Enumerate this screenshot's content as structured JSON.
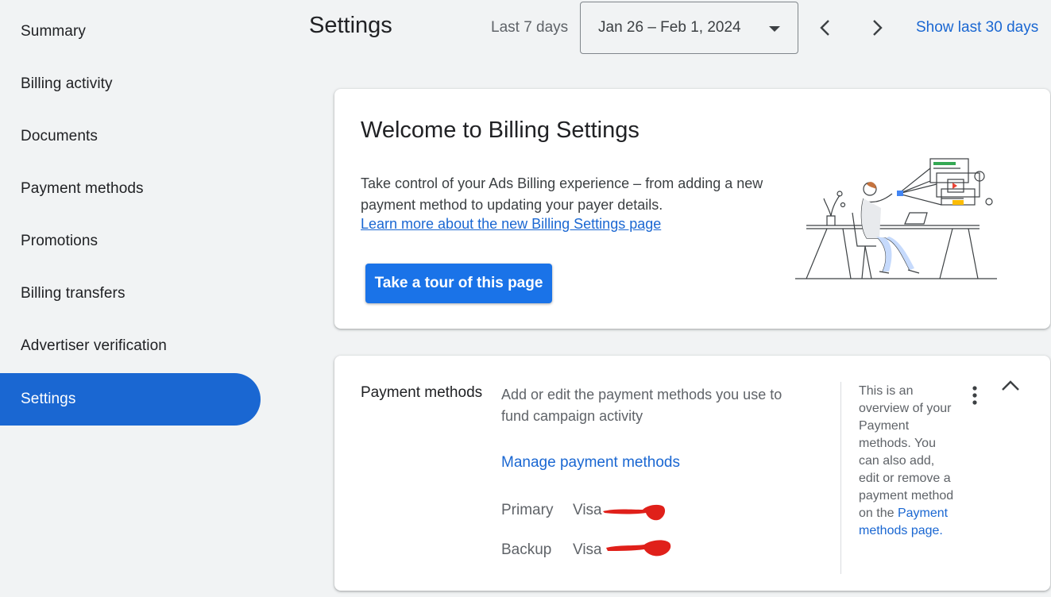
{
  "sidebar": {
    "items": [
      {
        "label": "Summary"
      },
      {
        "label": "Billing activity"
      },
      {
        "label": "Documents"
      },
      {
        "label": "Payment methods"
      },
      {
        "label": "Promotions"
      },
      {
        "label": "Billing transfers"
      },
      {
        "label": "Advertiser verification"
      },
      {
        "label": "Settings",
        "active": true
      }
    ]
  },
  "header": {
    "title": "Settings",
    "range_label": "Last 7 days",
    "date_range": "Jan 26 – Feb 1, 2024",
    "show_last_30": "Show last 30 days"
  },
  "welcome": {
    "title": "Welcome to Billing Settings",
    "description": "Take control of your Ads Billing experience – from adding a new payment method to updating your payer details.",
    "learn_link": "Learn more about the new Billing Settings page",
    "tour_button": "Take a tour of this page"
  },
  "payment_methods": {
    "title": "Payment methods",
    "description": "Add or edit the payment methods you use to fund campaign activity",
    "manage_link": "Manage payment methods",
    "primary_label": "Primary",
    "primary_value": "Visa",
    "backup_label": "Backup",
    "backup_value": "Visa",
    "help_text": "This is an overview of your Payment methods. You can also add, edit or remove a payment method on the",
    "help_link": "Payment methods page."
  },
  "colors": {
    "accent": "#1a67d2",
    "button": "#1a73e8",
    "background": "#f1f3f4",
    "redaction": "#e0201a"
  },
  "icons": [
    "chevron-left-icon",
    "chevron-right-icon",
    "dropdown-caret-icon",
    "more-vert-icon",
    "chevron-up-icon"
  ]
}
